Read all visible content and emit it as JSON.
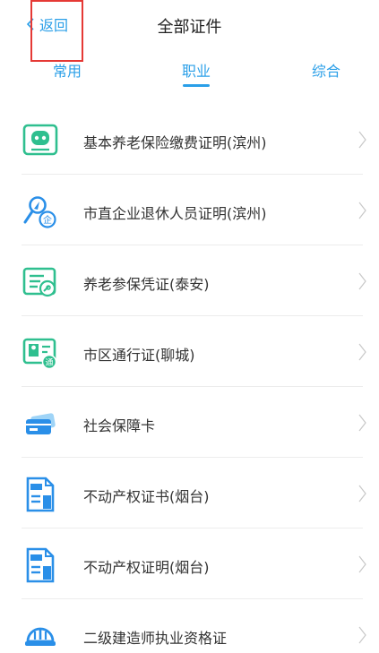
{
  "header": {
    "back_label": "返回",
    "title": "全部证件"
  },
  "tabs": [
    {
      "label": "常用",
      "selected": false
    },
    {
      "label": "职业",
      "selected": true
    },
    {
      "label": "综合",
      "selected": false
    }
  ],
  "items": [
    {
      "label": "基本养老保险缴费证明(滨州)",
      "icon": "pension-certificate-icon"
    },
    {
      "label": "市直企业退休人员证明(滨州)",
      "icon": "retired-person-icon"
    },
    {
      "label": "养老参保凭证(泰安)",
      "icon": "insurance-voucher-icon"
    },
    {
      "label": "市区通行证(聊城)",
      "icon": "pass-card-icon"
    },
    {
      "label": "社会保障卡",
      "icon": "social-security-card-icon"
    },
    {
      "label": "不动产权证书(烟台)",
      "icon": "property-certificate-icon"
    },
    {
      "label": "不动产权证明(烟台)",
      "icon": "property-proof-icon"
    },
    {
      "label": "二级建造师执业资格证",
      "icon": "hard-hat-icon"
    }
  ],
  "colors": {
    "accent": "#2a9fe8",
    "icon_green": "#2fbf8f",
    "icon_blue": "#2a8fe8",
    "highlight": "#e53935"
  }
}
